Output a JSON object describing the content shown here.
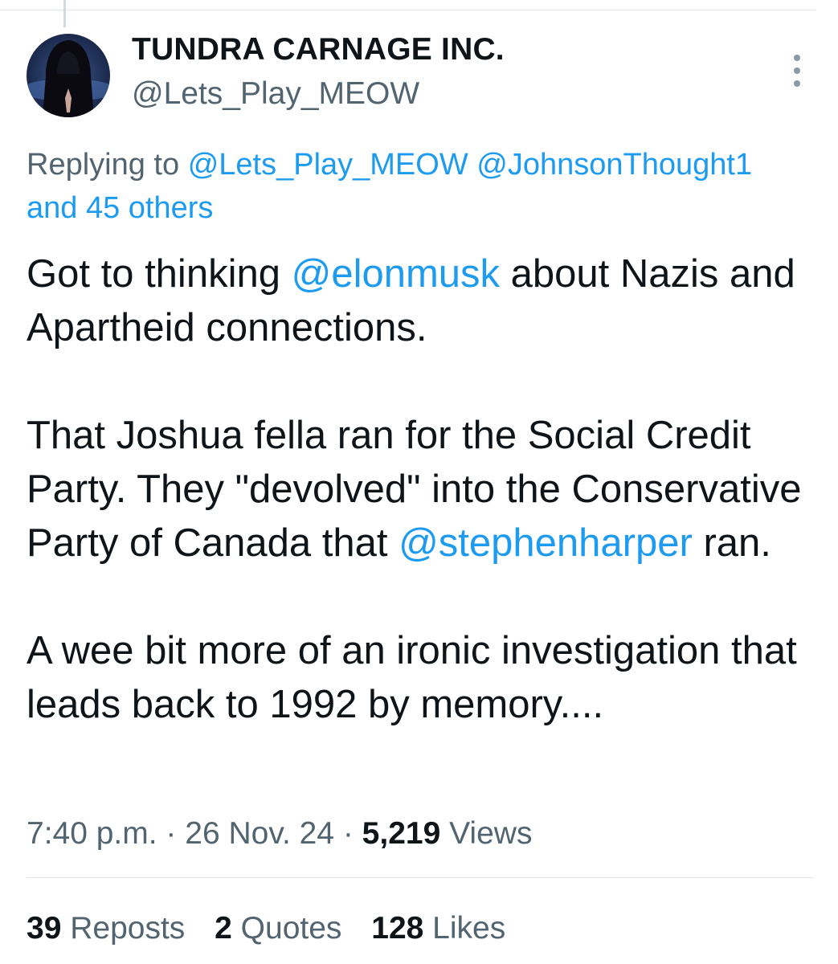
{
  "author": {
    "display_name": "TUNDRA CARNAGE INC.",
    "handle": "@Lets_Play_MEOW"
  },
  "icons": {
    "more": "more-vertical-icon",
    "avatar": "hooded-figure-avatar"
  },
  "reply": {
    "prefix": "Replying to",
    "mention1": "@Lets_Play_MEOW",
    "mention2": "@JohnsonThought1",
    "others": "and 45 others"
  },
  "tweet": {
    "p1_a": "Got to thinking ",
    "p1_mention": "@elonmusk",
    "p1_b": " about Nazis and Apartheid connections.",
    "p2_a": "That Joshua fella ran for the Social Credit Party. They \"devolved\" into the Conservative Party of Canada that ",
    "p2_mention": "@stephenharper",
    "p2_b": " ran.",
    "p3": "A wee bit more of an ironic investigation that leads back to 1992 by memory...."
  },
  "meta": {
    "time": "7:40 p.m.",
    "sep": " · ",
    "date": "26 Nov. 24",
    "views_count": "5,219",
    "views_label": " Views"
  },
  "stats": {
    "reposts_count": "39",
    "reposts_label": " Reposts",
    "quotes_count": "2",
    "quotes_label": " Quotes",
    "likes_count": "128",
    "likes_label": " Likes"
  },
  "colors": {
    "link": "#1d9bf0",
    "secondary": "#536471",
    "primary": "#0f1419"
  }
}
